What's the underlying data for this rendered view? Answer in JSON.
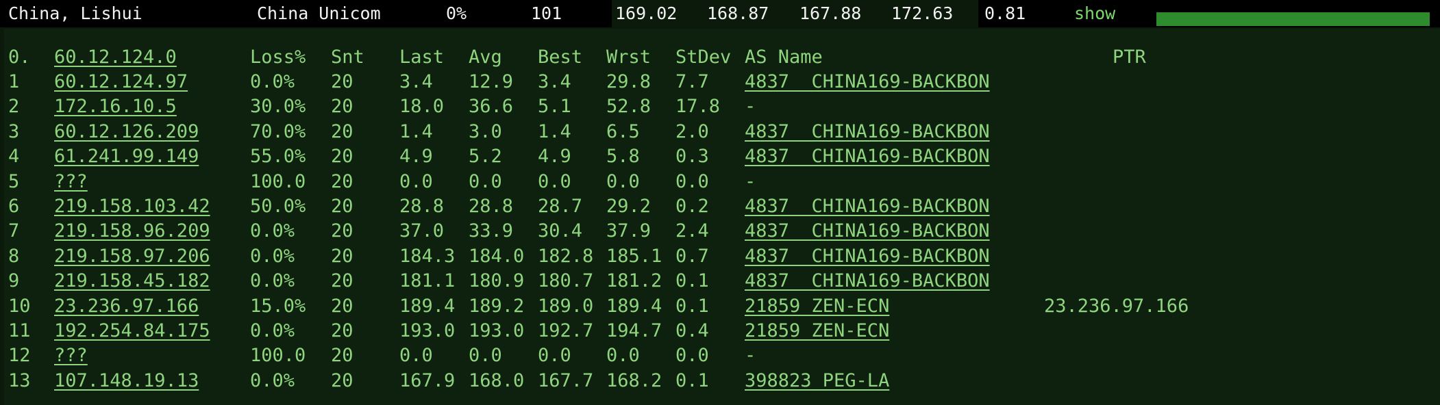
{
  "summary": {
    "location": "China, Lishui",
    "isp": "China Unicom",
    "loss": "0%",
    "hops": "101",
    "metrics": [
      "169.02",
      "168.87",
      "167.88",
      "172.63",
      "0.81"
    ],
    "show_link": "show",
    "bar_fill_fraction": 1.0
  },
  "table": {
    "header": {
      "hop": "0.",
      "host": "60.12.124.0",
      "loss": "Loss%",
      "snt": "Snt",
      "last": "Last",
      "avg": "Avg",
      "best": "Best",
      "wrst": "Wrst",
      "stdev": "StDev",
      "as_name": "AS Name",
      "ptr": "PTR"
    },
    "rows": [
      {
        "hop": "1",
        "host": "60.12.124.97",
        "loss": "0.0%",
        "snt": "20",
        "last": "3.4",
        "avg": "12.9",
        "best": "3.4",
        "wrst": "29.8",
        "stdev": "7.7",
        "as": "4837  CHINA169-BACKBON",
        "as_link": true,
        "ptr": ""
      },
      {
        "hop": "2",
        "host": "172.16.10.5",
        "loss": "30.0%",
        "snt": "20",
        "last": "18.0",
        "avg": "36.6",
        "best": "5.1",
        "wrst": "52.8",
        "stdev": "17.8",
        "as": "-",
        "as_link": false,
        "ptr": ""
      },
      {
        "hop": "3",
        "host": "60.12.126.209",
        "loss": "70.0%",
        "snt": "20",
        "last": "1.4",
        "avg": "3.0",
        "best": "1.4",
        "wrst": "6.5",
        "stdev": "2.0",
        "as": "4837  CHINA169-BACKBON",
        "as_link": true,
        "ptr": ""
      },
      {
        "hop": "4",
        "host": "61.241.99.149",
        "loss": "55.0%",
        "snt": "20",
        "last": "4.9",
        "avg": "5.2",
        "best": "4.9",
        "wrst": "5.8",
        "stdev": "0.3",
        "as": "4837  CHINA169-BACKBON",
        "as_link": true,
        "ptr": ""
      },
      {
        "hop": "5",
        "host": "???",
        "loss": "100.0",
        "snt": "20",
        "last": "0.0",
        "avg": "0.0",
        "best": "0.0",
        "wrst": "0.0",
        "stdev": "0.0",
        "as": "-",
        "as_link": false,
        "ptr": ""
      },
      {
        "hop": "6",
        "host": "219.158.103.42",
        "loss": "50.0%",
        "snt": "20",
        "last": "28.8",
        "avg": "28.8",
        "best": "28.7",
        "wrst": "29.2",
        "stdev": "0.2",
        "as": "4837  CHINA169-BACKBON",
        "as_link": true,
        "ptr": ""
      },
      {
        "hop": "7",
        "host": "219.158.96.209",
        "loss": "0.0%",
        "snt": "20",
        "last": "37.0",
        "avg": "33.9",
        "best": "30.4",
        "wrst": "37.9",
        "stdev": "2.4",
        "as": "4837  CHINA169-BACKBON",
        "as_link": true,
        "ptr": ""
      },
      {
        "hop": "8",
        "host": "219.158.97.206",
        "loss": "0.0%",
        "snt": "20",
        "last": "184.3",
        "avg": "184.0",
        "best": "182.8",
        "wrst": "185.1",
        "stdev": "0.7",
        "as": "4837  CHINA169-BACKBON",
        "as_link": true,
        "ptr": ""
      },
      {
        "hop": "9",
        "host": "219.158.45.182",
        "loss": "0.0%",
        "snt": "20",
        "last": "181.1",
        "avg": "180.9",
        "best": "180.7",
        "wrst": "181.2",
        "stdev": "0.1",
        "as": "4837  CHINA169-BACKBON",
        "as_link": true,
        "ptr": ""
      },
      {
        "hop": "10",
        "host": "23.236.97.166",
        "loss": "15.0%",
        "snt": "20",
        "last": "189.4",
        "avg": "189.2",
        "best": "189.0",
        "wrst": "189.4",
        "stdev": "0.1",
        "as": "21859 ZEN-ECN",
        "as_link": true,
        "ptr": "23.236.97.166"
      },
      {
        "hop": "11",
        "host": "192.254.84.175",
        "loss": "0.0%",
        "snt": "20",
        "last": "193.0",
        "avg": "193.0",
        "best": "192.7",
        "wrst": "194.7",
        "stdev": "0.4",
        "as": "21859 ZEN-ECN",
        "as_link": true,
        "ptr": ""
      },
      {
        "hop": "12",
        "host": "???",
        "loss": "100.0",
        "snt": "20",
        "last": "0.0",
        "avg": "0.0",
        "best": "0.0",
        "wrst": "0.0",
        "stdev": "0.0",
        "as": "-",
        "as_link": false,
        "ptr": ""
      },
      {
        "hop": "13",
        "host": "107.148.19.13",
        "loss": "0.0%",
        "snt": "20",
        "last": "167.9",
        "avg": "168.0",
        "best": "167.7",
        "wrst": "168.2",
        "stdev": "0.1",
        "as": "398823 PEG-LA",
        "as_link": true,
        "ptr": ""
      }
    ]
  }
}
